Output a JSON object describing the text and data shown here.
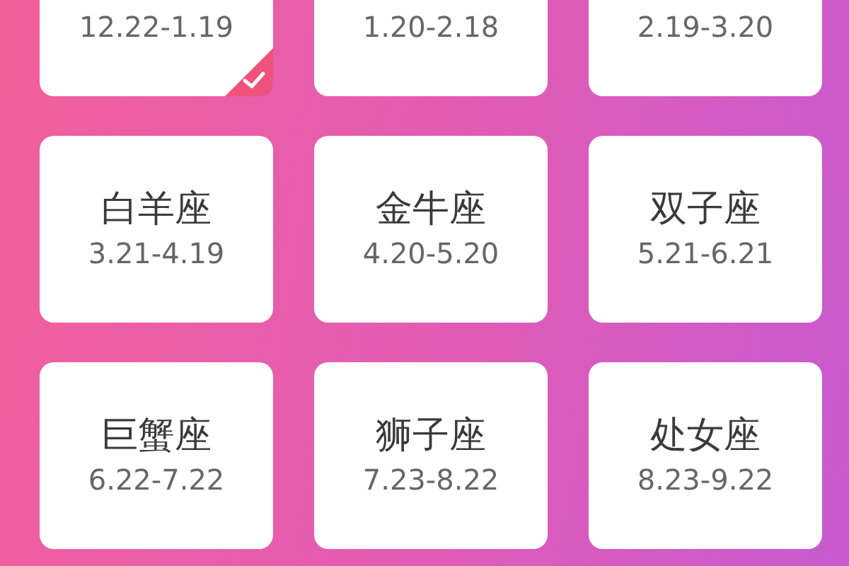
{
  "signs": [
    {
      "dates": "12.22-1.19",
      "selected": true
    },
    {
      "dates": "1.20-2.18",
      "selected": false
    },
    {
      "dates": "2.19-3.20",
      "selected": false
    },
    {
      "name": "白羊座",
      "dates": "3.21-4.19",
      "selected": false
    },
    {
      "name": "金牛座",
      "dates": "4.20-5.20",
      "selected": false
    },
    {
      "name": "双子座",
      "dates": "5.21-6.21",
      "selected": false
    },
    {
      "name": "巨蟹座",
      "dates": "6.22-7.22",
      "selected": false
    },
    {
      "name": "狮子座",
      "dates": "7.23-8.22",
      "selected": false
    },
    {
      "name": "处女座",
      "dates": "8.23-9.22",
      "selected": false
    }
  ]
}
